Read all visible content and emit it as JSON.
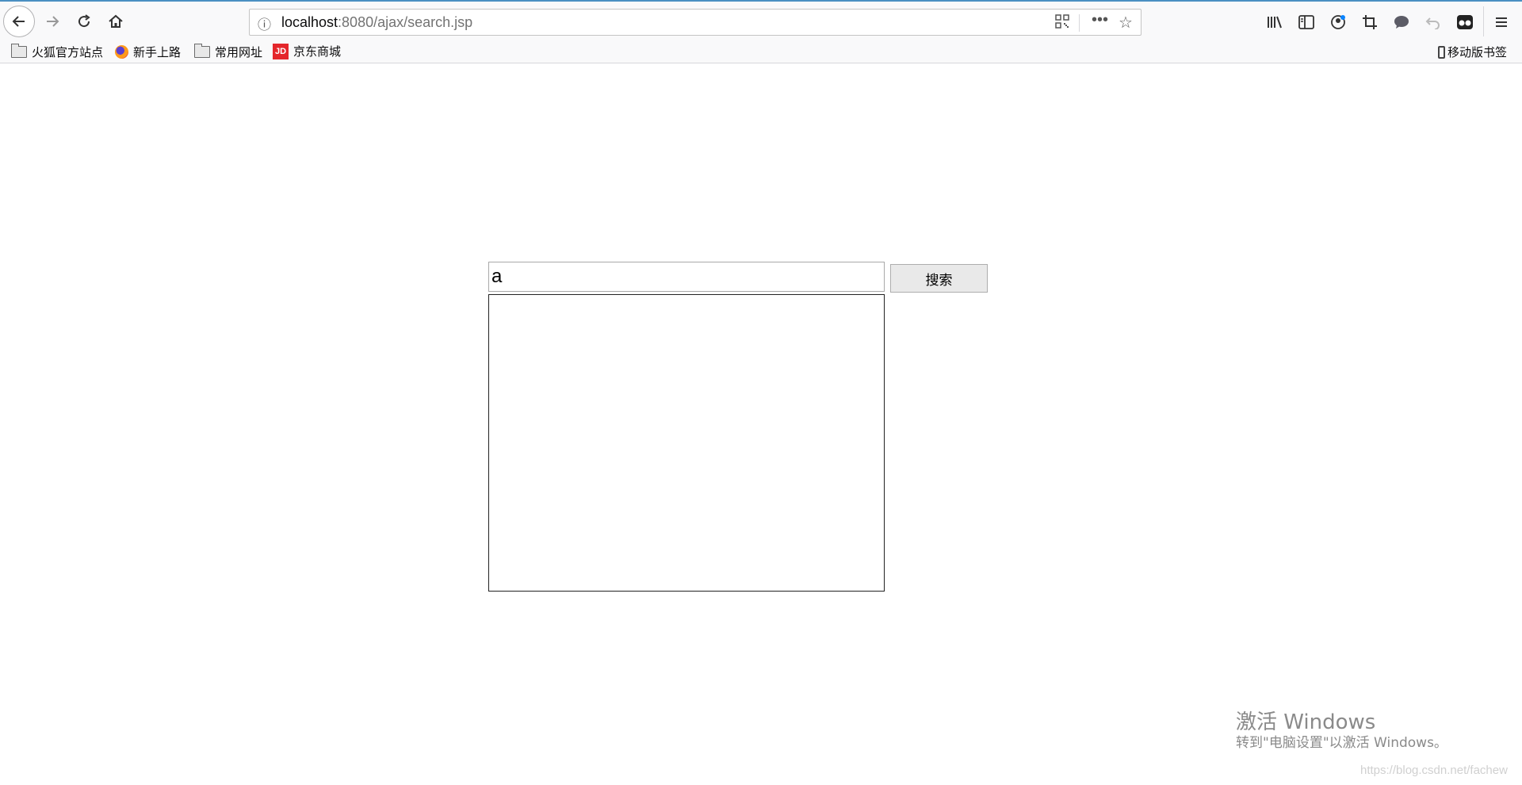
{
  "browser": {
    "url_host": "localhost",
    "url_rest": ":8080/ajax/search.jsp",
    "icons": {
      "back": "back-arrow-icon",
      "forward": "forward-arrow-icon",
      "reload": "reload-icon",
      "home": "home-icon",
      "site_info": "info-icon",
      "qr": "qr-code-icon",
      "more": "more-icon",
      "bookmark_star": "star-icon",
      "library": "library-icon",
      "sidebar": "sidebar-icon",
      "account": "account-icon",
      "screenshot": "crop-icon",
      "chat": "chat-icon",
      "undo": "undo-icon",
      "extension": "extension-icon",
      "menu": "hamburger-menu-icon"
    }
  },
  "bookmarks": {
    "items": [
      {
        "label": "火狐官方站点",
        "icon": "folder-icon"
      },
      {
        "label": "新手上路",
        "icon": "firefox-icon"
      },
      {
        "label": "常用网址",
        "icon": "folder-icon"
      },
      {
        "label": "京东商城",
        "icon": "jd-logo-icon"
      }
    ],
    "jd_logo_text": "JD",
    "mobile_label": "移动版书签"
  },
  "page": {
    "search_value": "a",
    "search_button_label": "搜索"
  },
  "watermark": {
    "title": "激活 Windows",
    "subtitle": "转到\"电脑设置\"以激活 Windows。"
  },
  "source_url": "https://blog.csdn.net/fachew"
}
